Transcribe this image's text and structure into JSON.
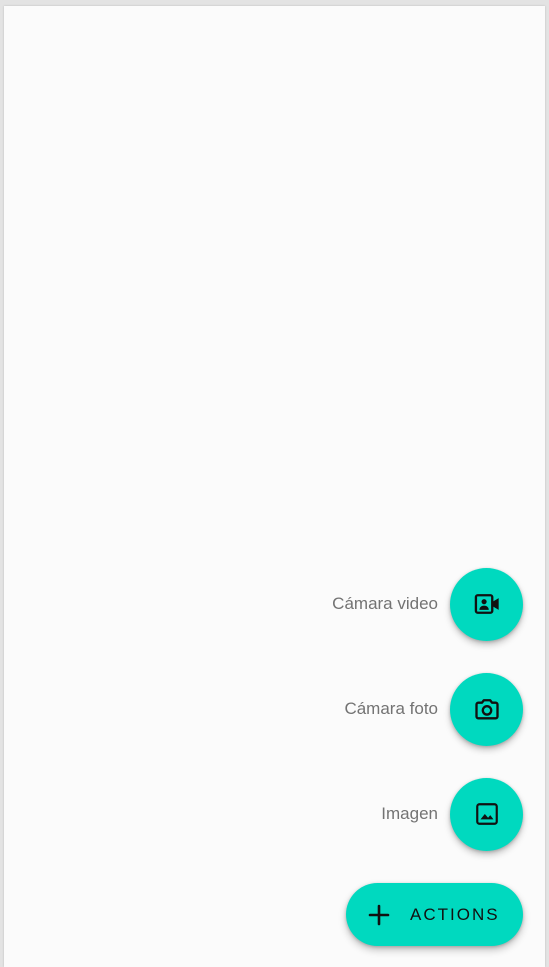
{
  "theme": {
    "fab_color": "#00d9bf",
    "icon_color": "#111111",
    "label_color": "#737373",
    "background": "#fbfbfb"
  },
  "fab_menu": {
    "items": [
      {
        "label": "Cámara video",
        "icon": "video-camera-icon"
      },
      {
        "label": "Cámara foto",
        "icon": "photo-camera-icon"
      },
      {
        "label": "Imagen",
        "icon": "image-icon"
      }
    ],
    "main": {
      "label": "ACTIONS",
      "icon": "plus-icon"
    }
  }
}
